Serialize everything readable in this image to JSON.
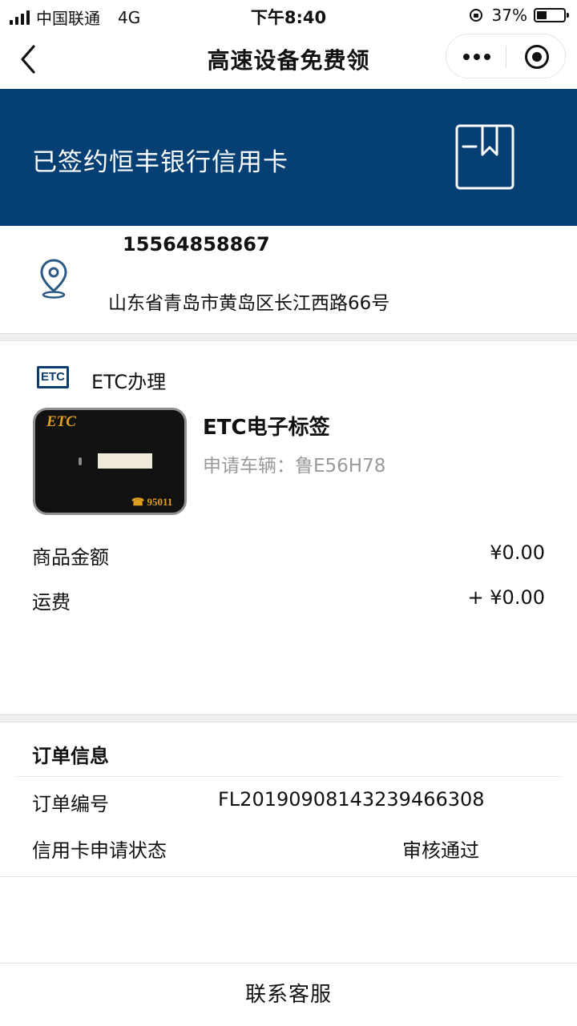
{
  "status_bar": {
    "carrier": "中国联通",
    "network": "4G",
    "time": "下午8:40",
    "battery_text": "37%",
    "battery_level": 0.37
  },
  "nav": {
    "title": "高速设备免费领",
    "icons": {
      "back": "back-chevron-icon",
      "more": "more-dots-icon",
      "close": "target-circle-icon"
    }
  },
  "banner": {
    "text": "已签约恒丰银行信用卡",
    "background": "#053f73",
    "icon": "bookmark-box-icon"
  },
  "address": {
    "phone": "15564858867",
    "text": "山东省青岛市黄岛区长江西路66号",
    "icon": "location-pin-icon",
    "accent": "#2c5a86"
  },
  "product": {
    "badge": "ETC",
    "section_label": "ETC办理",
    "card_logo": "ETC",
    "card_phone": "95011",
    "name": "ETC电子标签",
    "vehicle_label": "申请车辆：",
    "vehicle_plate": "鲁E56H78",
    "amount_label": "商品金额",
    "amount_value": "¥0.00",
    "shipping_label": "运费",
    "shipping_value": "+ ¥0.00"
  },
  "order": {
    "title": "订单信息",
    "number_label": "订单编号",
    "number_value": "FL20190908143239466308",
    "status_label": "信用卡申请状态",
    "status_value": "审核通过"
  },
  "footer": {
    "contact_label": "联系客服"
  }
}
